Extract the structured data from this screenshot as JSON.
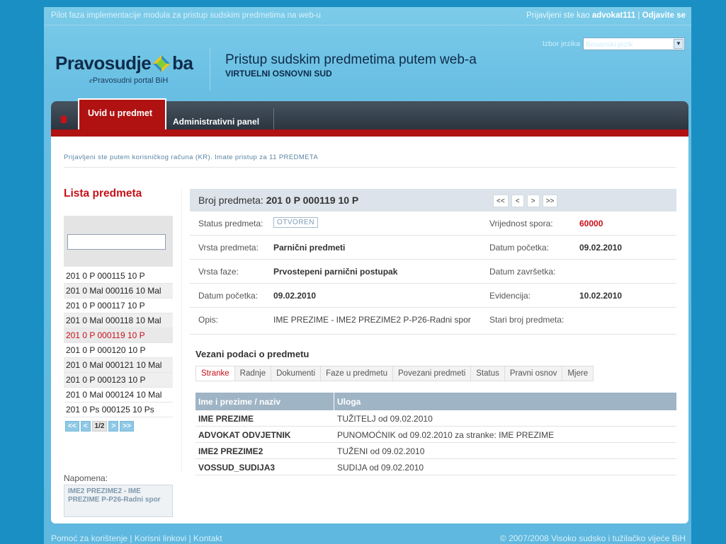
{
  "topbar": {
    "notice": "Pilot faza implementacije modula za pristup sudskim predmetima na web-u",
    "logged_prefix": "Prijavljeni ste kao",
    "username": "advokat111",
    "separator": "|",
    "logout": "Odjavite se"
  },
  "logo": {
    "word1": "Pravosudje",
    "word2": "ba",
    "sub_e": "e",
    "sub_rest": "Pravosudni portal BiH"
  },
  "header": {
    "title": "Pristup sudskim predmetima putem web-a",
    "subtitle": "VIRTUELNI OSNOVNI SUD"
  },
  "language": {
    "label": "Izbor jezika",
    "selected": "Bosanski jezik"
  },
  "nav": {
    "tab_active": "Uvid u predmet",
    "tab_admin": "Administrativni panel"
  },
  "notice": "Prijavljeni ste putem korisničkog računa (KR). Imate pristup za 11 PREDMETA",
  "sidebar": {
    "title": "Lista predmeta",
    "search_value": "",
    "items": [
      "201 0 P 000115 10 P",
      "201 0 Mal 000116 10 Mal",
      "201 0 P 000117 10 P",
      "201 0 Mal 000118 10 Mal",
      "201 0 P 000119 10 P",
      "201 0 P 000120 10 P",
      "201 0 Mal 000121 10 Mal",
      "201 0 P 000123 10 P",
      "201 0 Mal 000124 10 Mal",
      "201 0 Ps 000125 10 Ps"
    ],
    "pager": {
      "first": "<<",
      "prev": "<",
      "current": "1/2",
      "next": ">",
      "last": ">>"
    },
    "note_label": "Napomena:",
    "note_text": "IME2 PREZIME2 - IME PREZIME P-P26-Radni spor"
  },
  "case": {
    "label": "Broj predmeta:",
    "number": "201 0 P 000119 10 P",
    "pager": {
      "first": "<<",
      "prev": "<",
      "next": ">",
      "last": ">>"
    },
    "fields": {
      "status_label": "Status predmeta:",
      "status_value": "OTVOREN",
      "vrijednost_label": "Vrijednost spora:",
      "vrijednost_value": "60000",
      "vrsta_label": "Vrsta predmeta:",
      "vrsta_value": "Parnični predmeti",
      "datum_poc_label": "Datum početka:",
      "datum_poc_value": "09.02.2010",
      "faza_label": "Vrsta faze:",
      "faza_value": "Prvostepeni parnični postupak",
      "datum_zav_label": "Datum završetka:",
      "datum_zav_value": "",
      "datum_poc2_label": "Datum početka:",
      "datum_poc2_value": "09.02.2010",
      "evidencija_label": "Evidencija:",
      "evidencija_value": "10.02.2010",
      "opis_label": "Opis:",
      "opis_value": "IME PREZIME - IME2 PREZIME2 P-P26-Radni spor",
      "stari_label": "Stari broj predmeta:",
      "stari_value": ""
    }
  },
  "related": {
    "title": "Vezani podaci o predmetu",
    "tabs": [
      "Stranke",
      "Radnje",
      "Dokumenti",
      "Faze u predmetu",
      "Povezani predmeti",
      "Status",
      "Pravni osnov",
      "Mjere"
    ],
    "headers": [
      "Ime i prezime / naziv",
      "Uloga"
    ],
    "rows": [
      [
        "IME PREZIME",
        "TUŽITELJ od 09.02.2010"
      ],
      [
        "ADVOKAT ODVJETNIK",
        "PUNOMOĆNIK od 09.02.2010 za stranke: IME PREZIME"
      ],
      [
        "IME2 PREZIME2",
        "TUŽENI od 09.02.2010"
      ],
      [
        "VOSSUD_SUDIJA3",
        "SUDIJA od 09.02.2010"
      ]
    ]
  },
  "footer": {
    "help": "Pomoć za korištenje",
    "links": "Korisni linkovi",
    "contact": "Kontakt",
    "sep": "|",
    "copyright": "© 2007/2008 Visoko sudsko i tužilačko vijeće BiH"
  },
  "colors": {
    "accent_red": "#b01111",
    "brand_blue": "#1a8fc4",
    "text_red": "#c8101a"
  }
}
